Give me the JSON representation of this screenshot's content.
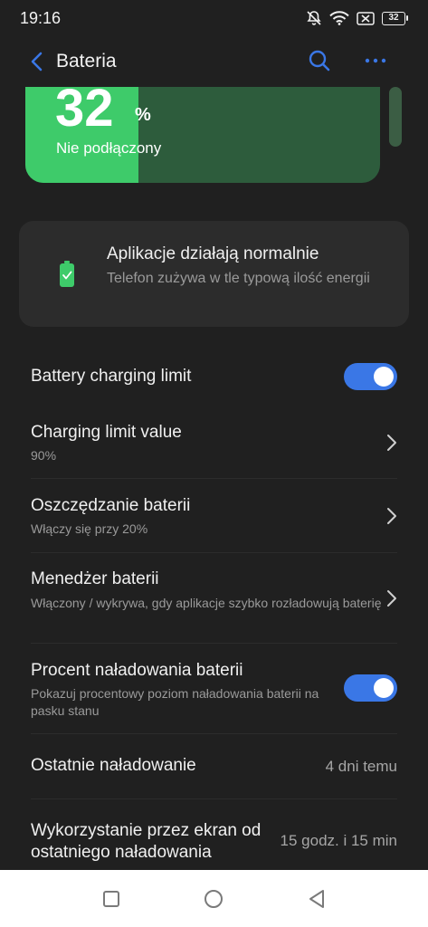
{
  "status_bar": {
    "time": "19:16",
    "battery_level": "32",
    "icons": [
      "bell-off-icon",
      "wifi-icon",
      "no-sim-icon",
      "battery-icon"
    ]
  },
  "app_bar": {
    "title": "Bateria",
    "back_icon": "chevron-left-icon",
    "search_icon": "search-icon",
    "more_icon": "more-horizontal-icon"
  },
  "battery_card": {
    "percent": "32",
    "percent_sign": "%",
    "status": "Nie podłączony",
    "level_fraction": 0.32,
    "fill_color": "#3ecb6a",
    "track_color": "#2d5c3c"
  },
  "apps_card": {
    "icon": "battery-check-icon",
    "title": "Aplikacje działają normalnie",
    "description": "Telefon zużywa w tle typową ilość energii"
  },
  "settings": [
    {
      "title": "Battery charging limit",
      "control": "toggle",
      "on": true
    },
    {
      "title": "Charging limit value",
      "subtitle": "90%",
      "control": "chevron"
    },
    {
      "title": "Oszczędzanie baterii",
      "subtitle": "Włączy się przy 20%",
      "control": "chevron"
    },
    {
      "title": "Menedżer baterii",
      "subtitle": "Włączony / wykrywa, gdy aplikacje szybko rozładowują baterię",
      "control": "chevron"
    },
    {
      "title": "Procent naładowania baterii",
      "subtitle": "Pokazuj procentowy poziom naładowania baterii na pasku stanu",
      "control": "toggle",
      "on": true
    },
    {
      "title": "Ostatnie naładowanie",
      "value": "4 dni temu"
    },
    {
      "title": "Wykorzystanie przez ekran od ostatniego naładowania",
      "value": "15 godz. i 15 min"
    }
  ],
  "nav_bar": {
    "buttons": [
      "recents-square-icon",
      "home-circle-icon",
      "back-triangle-icon"
    ]
  },
  "colors": {
    "background": "#202020",
    "accent": "#3a77e6",
    "battery_green": "#3ecb6a"
  }
}
